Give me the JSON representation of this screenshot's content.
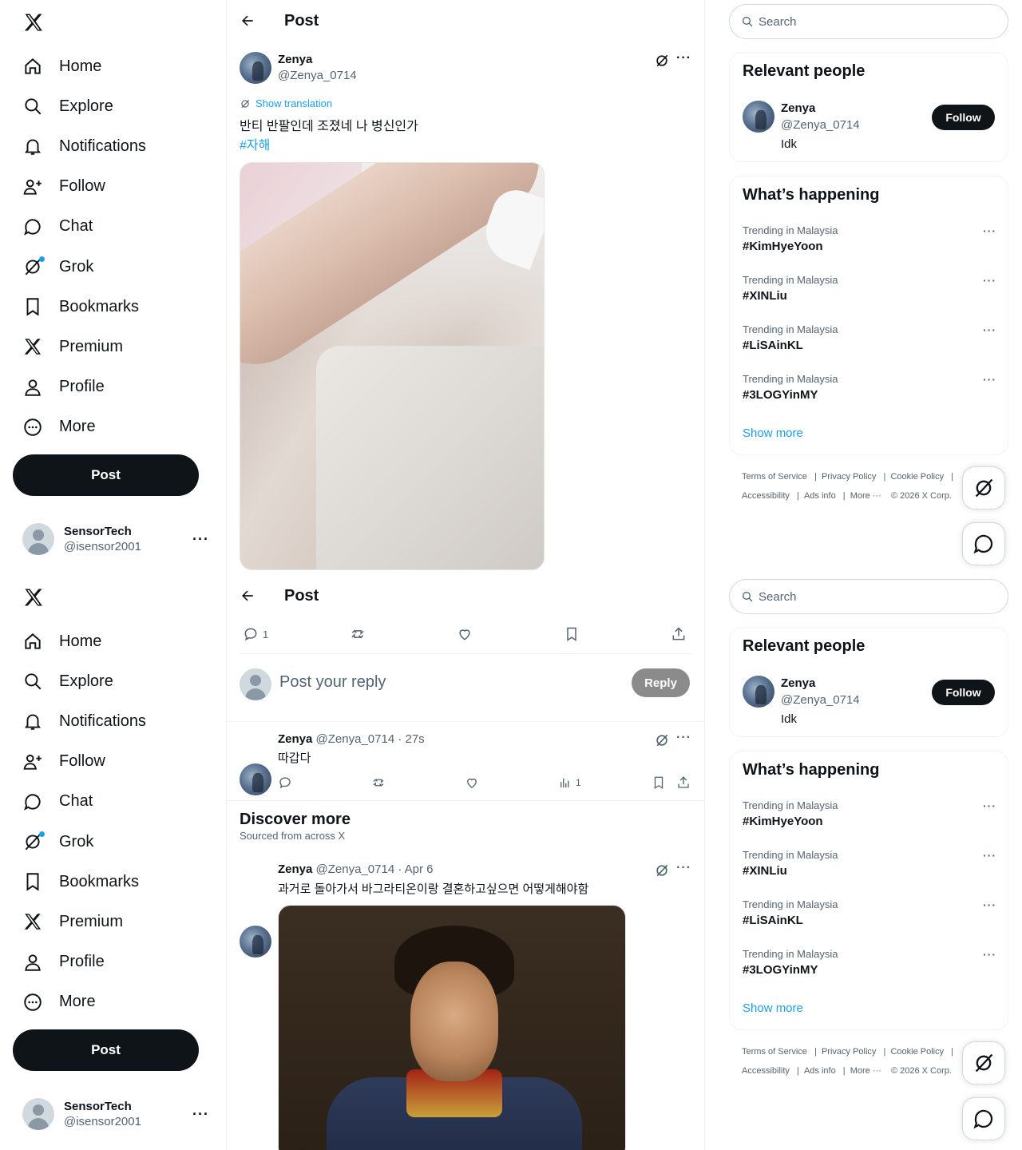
{
  "nav": {
    "items": [
      {
        "label": "Home",
        "icon": "home-icon"
      },
      {
        "label": "Explore",
        "icon": "search-icon"
      },
      {
        "label": "Notifications",
        "icon": "bell-icon"
      },
      {
        "label": "Follow",
        "icon": "person-add-icon"
      },
      {
        "label": "Chat",
        "icon": "chat-bubble-icon"
      },
      {
        "label": "Grok",
        "icon": "grok-icon"
      },
      {
        "label": "Bookmarks",
        "icon": "bookmark-icon"
      },
      {
        "label": "Premium",
        "icon": "x-logo-icon"
      },
      {
        "label": "Profile",
        "icon": "person-icon"
      },
      {
        "label": "More",
        "icon": "more-circle-icon"
      }
    ],
    "post_button": "Post"
  },
  "account": {
    "name": "SensorTech",
    "handle": "@isensor2001",
    "more": "···"
  },
  "header": {
    "title": "Post"
  },
  "post": {
    "author": "Zenya",
    "handle": "@Zenya_0714",
    "show_translation": "Show translation",
    "text": "반티 반팔인데 조졌네 나 병신인가",
    "hashtag": "#자해",
    "reply_count": "1"
  },
  "reply_box": {
    "placeholder": "Post your reply",
    "button": "Reply"
  },
  "reply": {
    "author": "Zenya",
    "meta": "@Zenya_0714 · 27s",
    "text": "따갑다",
    "views": "1"
  },
  "discover": {
    "title": "Discover more",
    "subtitle": "Sourced from across X"
  },
  "discover_post": {
    "author": "Zenya",
    "meta": "@Zenya_0714 · Apr 6",
    "text": "과거로 돌아가서 바그라티온이랑 결혼하고싶으면 어떻게해야함"
  },
  "right": {
    "search_placeholder": "Search",
    "relevant_title": "Relevant people",
    "person": {
      "name": "Zenya",
      "handle": "@Zenya_0714",
      "bio": "Idk",
      "follow": "Follow"
    },
    "happening_title": "What’s happening",
    "trends": [
      {
        "context": "Trending in Malaysia",
        "tag": "#KimHyeYoon"
      },
      {
        "context": "Trending in Malaysia",
        "tag": "#XINLiu"
      },
      {
        "context": "Trending in Malaysia",
        "tag": "#LiSAinKL"
      },
      {
        "context": "Trending in Malaysia",
        "tag": "#3LOGYinMY"
      }
    ],
    "show_more": "Show more",
    "footer": {
      "tos": "Terms of Service",
      "privacy": "Privacy Policy",
      "cookie": "Cookie Policy",
      "accessibility": "Accessibility",
      "ads": "Ads info",
      "more": "More ···",
      "copyright": "© 2026 X Corp."
    }
  },
  "colors": {
    "accent": "#1d9bf0",
    "text": "#0f1419",
    "muted": "#536471"
  }
}
